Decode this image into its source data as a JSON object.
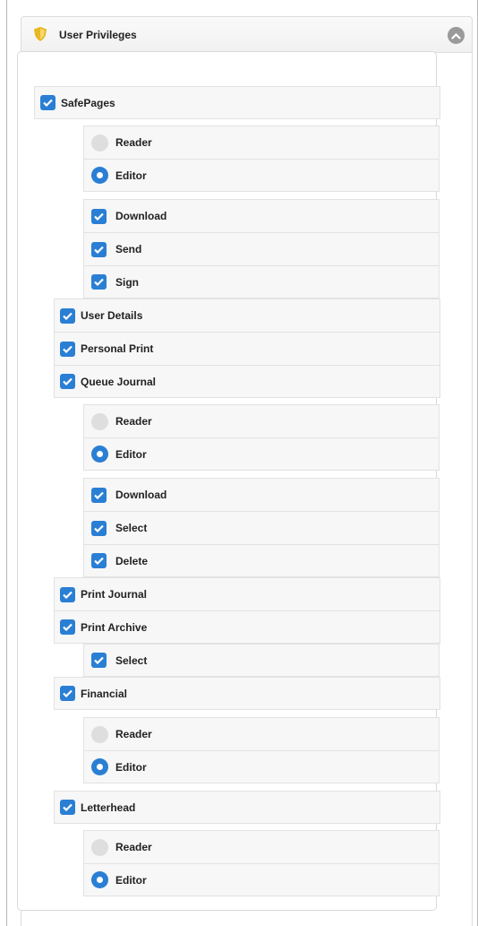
{
  "panel": {
    "title": "User Privileges",
    "icon": "shield-icon",
    "collapse_icon": "chevron-up-icon"
  },
  "colors": {
    "accent": "#2a7fd4",
    "unchecked": "#dedede",
    "shield": "#e8b824"
  },
  "privileges": {
    "safepages": {
      "label": "SafePages",
      "checked": true,
      "reader": "Reader",
      "editor": "Editor",
      "selected": "Editor",
      "download": "Download",
      "send": "Send",
      "sign": "Sign"
    },
    "user_details": {
      "label": "User Details",
      "checked": true
    },
    "personal_print": {
      "label": "Personal Print",
      "checked": true
    },
    "queue_journal": {
      "label": "Queue Journal",
      "checked": true,
      "reader": "Reader",
      "editor": "Editor",
      "selected": "Editor",
      "download": "Download",
      "select": "Select",
      "delete": "Delete"
    },
    "print_journal": {
      "label": "Print Journal",
      "checked": true
    },
    "print_archive": {
      "label": "Print Archive",
      "checked": true,
      "select": "Select"
    },
    "financial": {
      "label": "Financial",
      "checked": true,
      "reader": "Reader",
      "editor": "Editor",
      "selected": "Editor"
    },
    "letterhead": {
      "label": "Letterhead",
      "checked": true,
      "reader": "Reader",
      "editor": "Editor",
      "selected": "Editor"
    }
  }
}
